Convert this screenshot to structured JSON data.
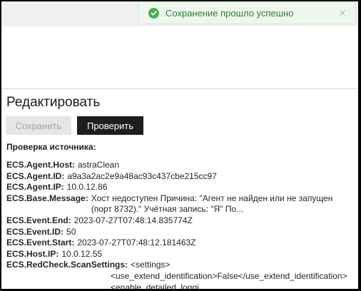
{
  "toast": {
    "message": "Сохранение прошло успешно",
    "color": "#4caf50"
  },
  "page": {
    "title": "Редактировать"
  },
  "buttons": {
    "save_label": "Сохранить",
    "check_label": "Проверить"
  },
  "source_check": {
    "label": "Проверка источника:",
    "fields": [
      {
        "key": "ECS.Agent.Host:",
        "value": "astraClean"
      },
      {
        "key": "ECS.Agent.ID:",
        "value": "a9a3a2ac2e9a48ac93c437cbe215cc97"
      },
      {
        "key": "ECS.Agent.IP:",
        "value": "10.0.12.86"
      },
      {
        "key": "ECS.Base.Message:",
        "value": "Хост недоступен Причина: \"Агент не найден или не запущен (порт 8732).\" Учётная запись: \"Я\" По..."
      },
      {
        "key": "ECS.Event.End:",
        "value": "2023-07-27T07:48:14.835774Z"
      },
      {
        "key": "ECS.Event.ID:",
        "value": "50"
      },
      {
        "key": "ECS.Event.Start:",
        "value": "2023-07-27T07:48:12.181463Z"
      },
      {
        "key": "ECS.Host.IP:",
        "value": "10.0.12.55"
      },
      {
        "key": "ECS.RedCheck.ScanSettings:",
        "value": "<settings>"
      }
    ],
    "scan_settings_lines": [
      "<use_extend_identification>False</use_extend_identification>",
      "<enable_detailed_loggi..."
    ]
  }
}
